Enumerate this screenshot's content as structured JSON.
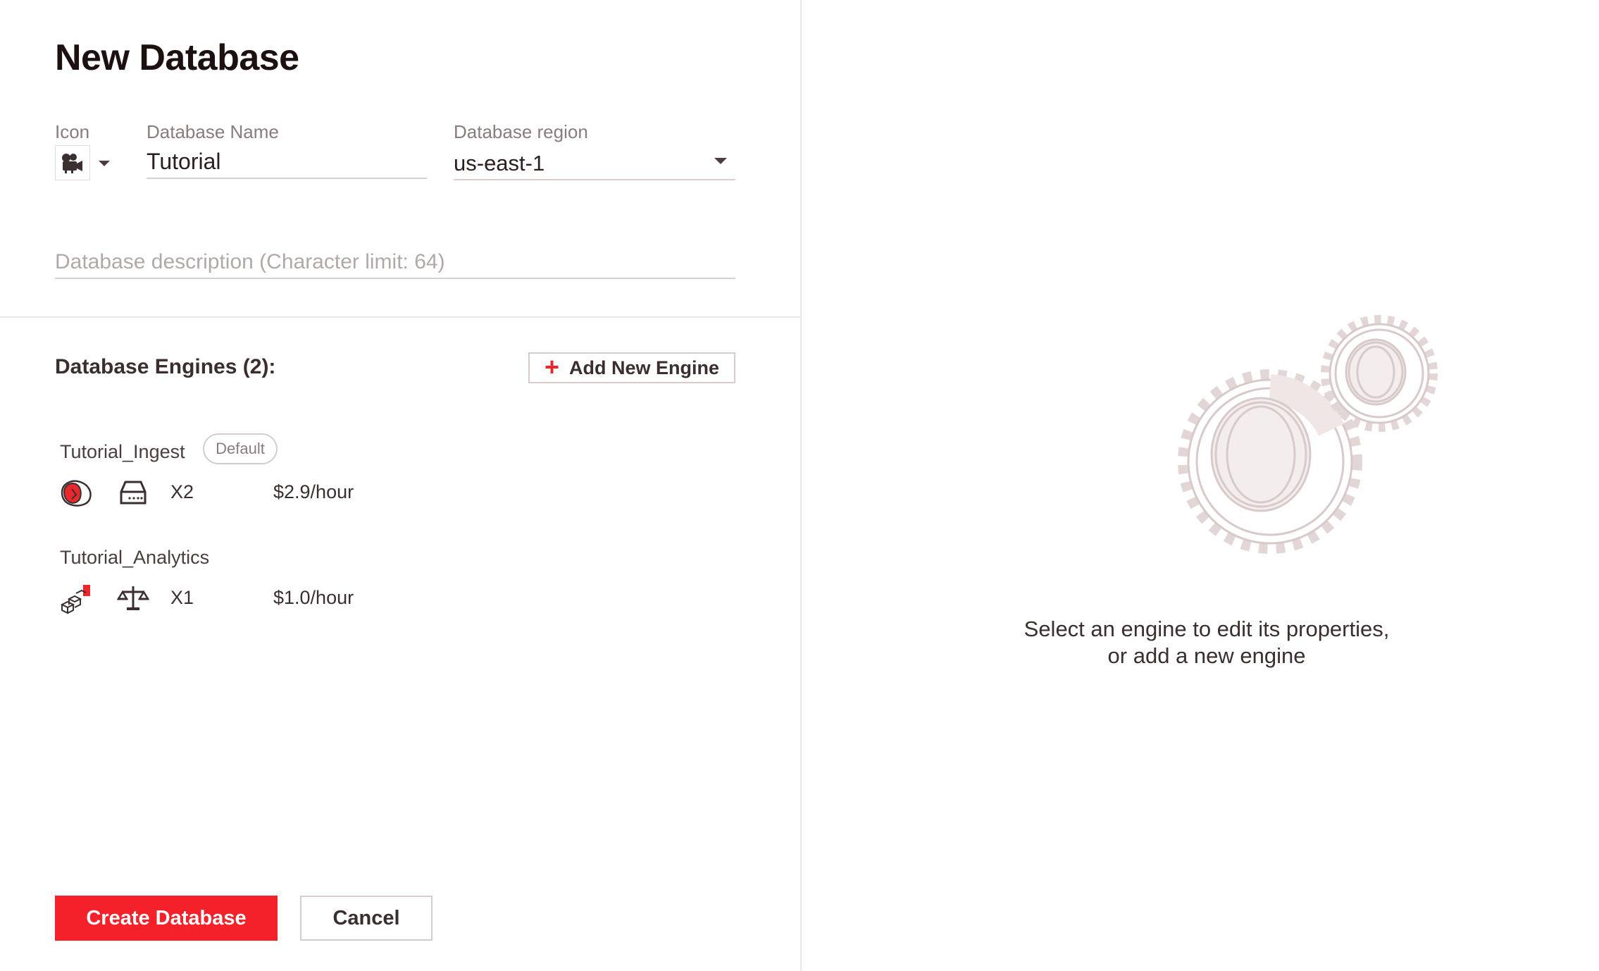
{
  "header": {
    "title": "New Database"
  },
  "form": {
    "icon_label": "Icon",
    "name_label": "Database Name",
    "name_value": "Tutorial",
    "region_label": "Database region",
    "region_value": "us-east-1",
    "description_placeholder": "Database description (Character limit: 64)"
  },
  "engines": {
    "title": "Database Engines (2):",
    "add_label": "Add New Engine",
    "items": [
      {
        "name": "Tutorial_Ingest",
        "badge": "Default",
        "type_icon": "spec-ingest-icon",
        "size_icon": "storage-drive-icon",
        "scale": "X2",
        "price": "$2.9/hour"
      },
      {
        "name": "Tutorial_Analytics",
        "type_icon": "spec-analytics-cubes-icon",
        "size_icon": "balance-scale-icon",
        "scale": "X1",
        "price": "$1.0/hour"
      }
    ]
  },
  "actions": {
    "create_label": "Create Database",
    "cancel_label": "Cancel"
  },
  "empty_state": {
    "line1": "Select an engine to edit its properties,",
    "line2": "or add a new engine",
    "illustration": "gears-illustration"
  },
  "colors": {
    "accent": "#f5212a",
    "text": "#3a2e2e",
    "muted": "#8a7c7c",
    "border": "#d6cccc"
  }
}
